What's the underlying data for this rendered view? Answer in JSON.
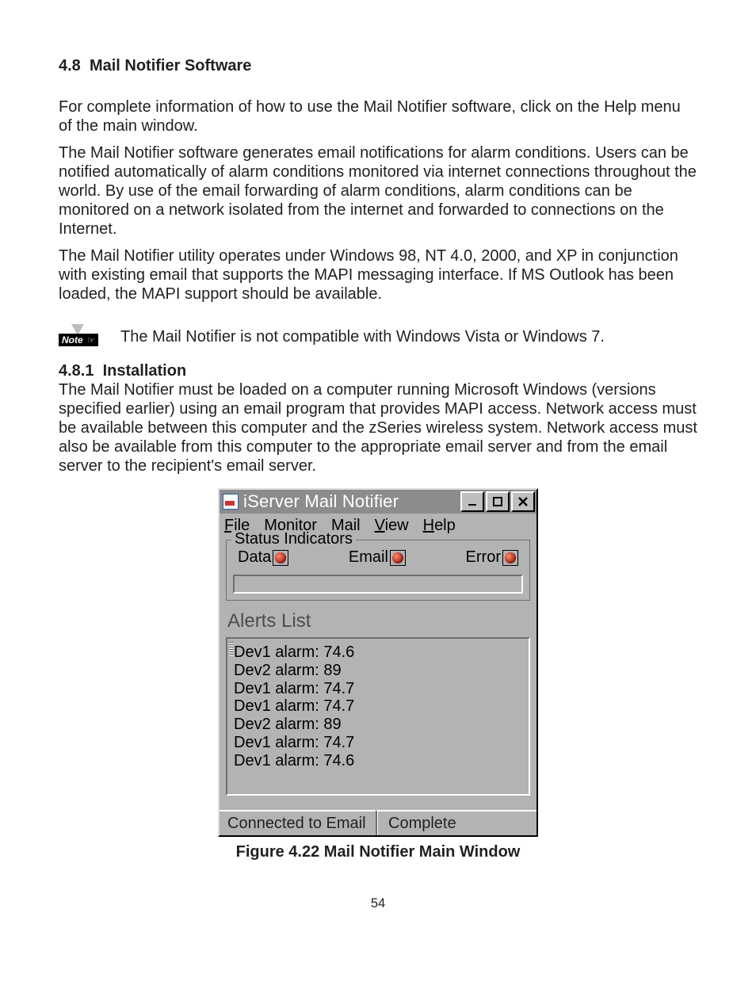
{
  "section": {
    "number": "4.8",
    "title": "Mail Notifier Software"
  },
  "paragraphs": {
    "p1": "For complete information of how to use the Mail Notifier software, click on the Help menu of the main window.",
    "p2": "The Mail Notifier software generates email notifications for alarm conditions. Users can be notified automatically of alarm conditions monitored via internet connections throughout the world. By use of the email forwarding of alarm conditions, alarm conditions can be monitored on a network isolated from the internet and forwarded to connections on the Internet.",
    "p3": "The Mail Notifier utility operates under Windows 98, NT 4.0, 2000, and XP in conjunction with existing email that supports the MAPI messaging interface. If MS Outlook has been loaded, the MAPI support should be available."
  },
  "note": {
    "label": "Note ☞",
    "text": "The Mail Notifier is not compatible with Windows Vista or Windows 7."
  },
  "subsection": {
    "number": "4.8.1",
    "title": "Installation",
    "body": "The Mail Notifier must be loaded on a computer running Microsoft Windows (versions specified earlier) using an email program that provides MAPI access. Network access must be available between this computer and the zSeries wireless system. Network access must also be available from this computer to the appropriate email server and from the email server to the recipient's email server."
  },
  "app": {
    "title": "iServer Mail Notifier",
    "menus": {
      "file": "File",
      "monitor": "Monitor",
      "mail": "Mail",
      "view": "View",
      "help": "Help"
    },
    "status_group_label": "Status Indicators",
    "indicators": {
      "data": "Data",
      "email": "Email",
      "error": "Error"
    },
    "alerts_label": "Alerts List",
    "alerts": [
      "Dev1 alarm: 74.6",
      "Dev2 alarm: 89",
      "Dev1 alarm: 74.7",
      "Dev1 alarm: 74.7",
      "Dev2 alarm: 89",
      "Dev1 alarm: 74.7",
      "Dev1 alarm: 74.6"
    ],
    "statusbar": {
      "left": "Connected to Email",
      "right": "Complete"
    }
  },
  "figure": {
    "caption": "Figure 4.22  Mail Notifier Main Window"
  },
  "page_number": "54"
}
